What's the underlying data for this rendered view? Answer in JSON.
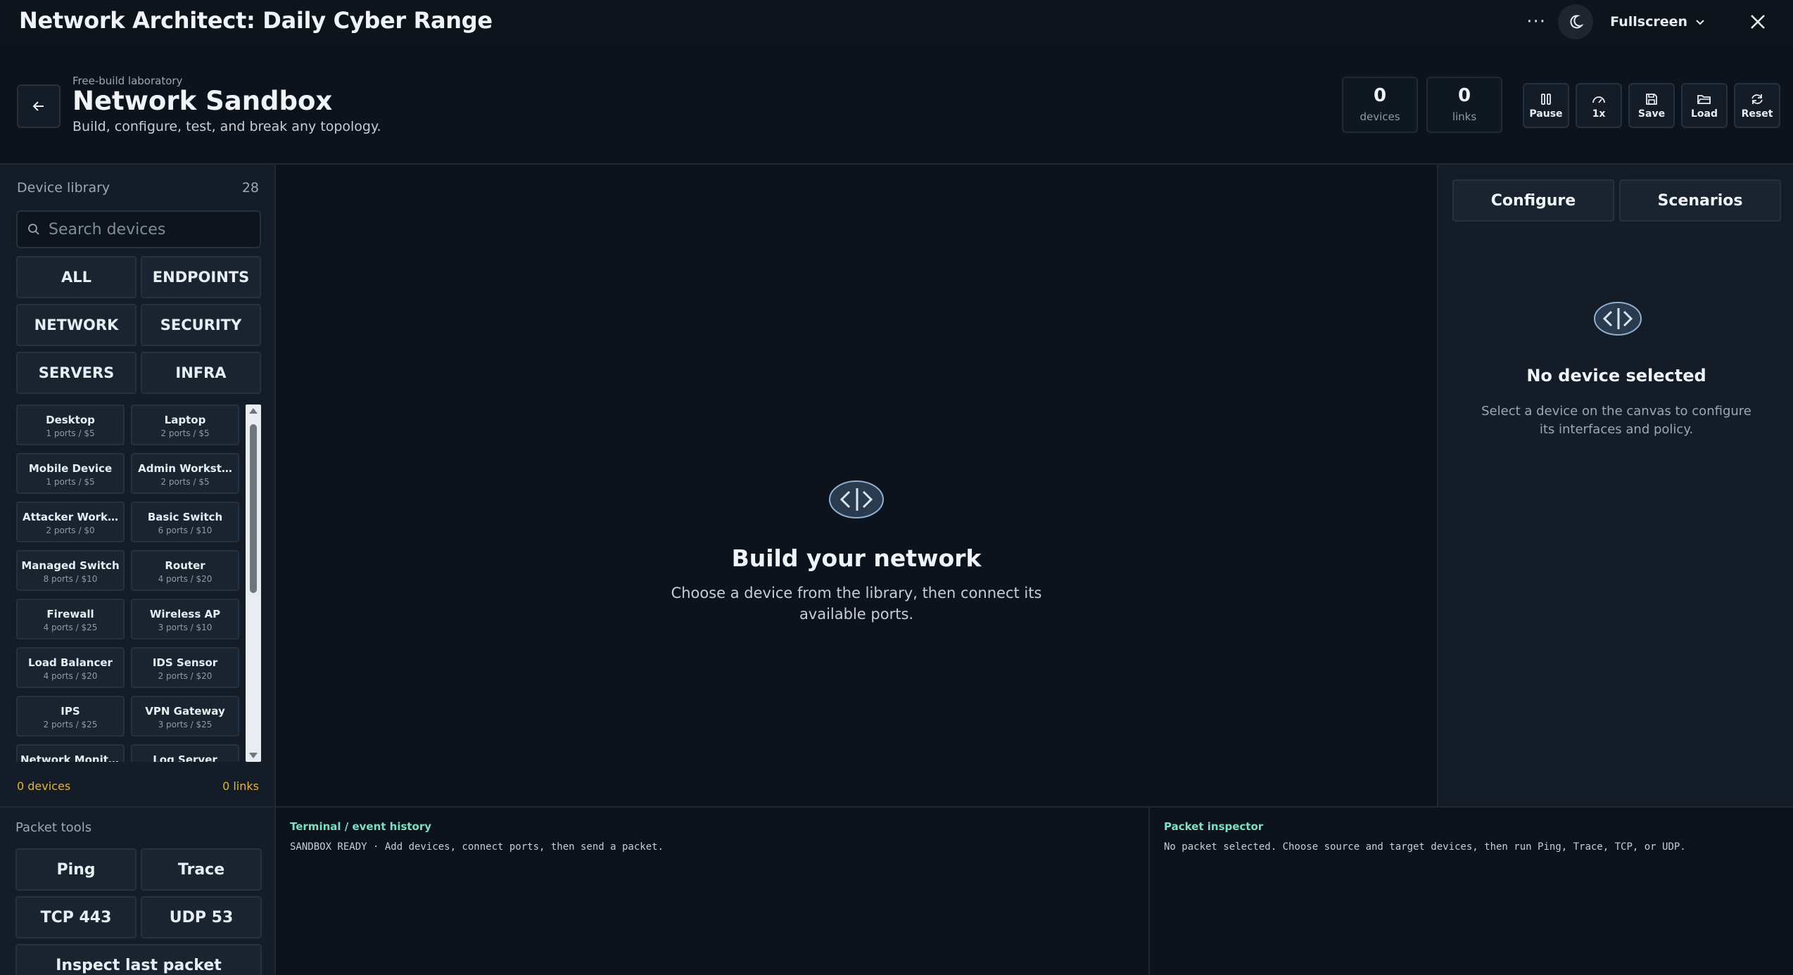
{
  "app": {
    "title": "Network Architect: Daily Cyber Range",
    "more_label": "···",
    "fullscreen_label": "Fullscreen"
  },
  "header": {
    "eyebrow": "Free-build laboratory",
    "title": "Network Sandbox",
    "subtitle": "Build, configure, test, and break any topology.",
    "stats": [
      {
        "value": "0",
        "label": "devices"
      },
      {
        "value": "0",
        "label": "links"
      }
    ],
    "tools": [
      {
        "label": "Pause",
        "icon": "pause-icon"
      },
      {
        "label": "1x",
        "icon": "speed-gauge-icon"
      },
      {
        "label": "Save",
        "icon": "save-icon"
      },
      {
        "label": "Load",
        "icon": "folder-open-icon"
      },
      {
        "label": "Reset",
        "icon": "reset-icon"
      }
    ]
  },
  "library": {
    "heading": "Device library",
    "count": "28",
    "search_placeholder": "Search devices",
    "categories": [
      "ALL",
      "ENDPOINTS",
      "NETWORK",
      "SECURITY",
      "SERVERS",
      "INFRA"
    ],
    "devices": [
      {
        "name": "Desktop",
        "meta": "1 ports / $5"
      },
      {
        "name": "Laptop",
        "meta": "2 ports / $5"
      },
      {
        "name": "Mobile Device",
        "meta": "1 ports / $5"
      },
      {
        "name": "Admin Workst…",
        "meta": "2 ports / $5"
      },
      {
        "name": "Attacker Work…",
        "meta": "2 ports / $0"
      },
      {
        "name": "Basic Switch",
        "meta": "6 ports / $10"
      },
      {
        "name": "Managed Switch",
        "meta": "8 ports / $10"
      },
      {
        "name": "Router",
        "meta": "4 ports / $20"
      },
      {
        "name": "Firewall",
        "meta": "4 ports / $25"
      },
      {
        "name": "Wireless AP",
        "meta": "3 ports / $10"
      },
      {
        "name": "Load Balancer",
        "meta": "4 ports / $20"
      },
      {
        "name": "IDS Sensor",
        "meta": "2 ports / $20"
      },
      {
        "name": "IPS",
        "meta": "2 ports / $25"
      },
      {
        "name": "VPN Gateway",
        "meta": "3 ports / $25"
      },
      {
        "name": "Network Monitor",
        "meta": ""
      },
      {
        "name": "Log Server",
        "meta": ""
      }
    ],
    "footer_devices": "0 devices",
    "footer_links": "0 links"
  },
  "canvas": {
    "empty_title": "Build your network",
    "empty_subtitle": "Choose a device from the library, then connect its available ports."
  },
  "right_panel": {
    "tabs": [
      "Configure",
      "Scenarios"
    ],
    "empty_title": "No device selected",
    "empty_subtitle": "Select a device on the canvas to configure its interfaces and policy."
  },
  "packet_tools": {
    "heading": "Packet tools",
    "buttons": [
      "Ping",
      "Trace",
      "TCP 443",
      "UDP 53",
      "Inspect last packet"
    ]
  },
  "terminal": {
    "heading": "Terminal / event history",
    "line": "SANDBOX READY · Add devices, connect ports, then send a packet."
  },
  "inspector": {
    "heading": "Packet inspector",
    "line": "No packet selected. Choose source and target devices, then run Ping, Trace, TCP, or UDP."
  },
  "colors": {
    "background": "#0c131c",
    "panel": "#141d27",
    "accent_teal": "#7ee0c3",
    "accent_amber": "#e3b341"
  }
}
